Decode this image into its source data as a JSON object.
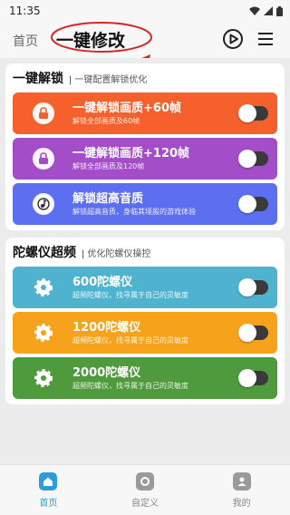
{
  "status_bar": {
    "time": "11:35"
  },
  "header": {
    "nav_home": "首页",
    "title": "一键修改",
    "annotation_color": "#d62828"
  },
  "sections": [
    {
      "title": "一键解锁",
      "subtitle": "一键配置解锁优化",
      "cards": [
        {
          "title": "一键解锁画质+60帧",
          "desc": "解锁全部画质及60帧",
          "color": "#f5602c",
          "icon": "lock-icon",
          "toggle_on": false
        },
        {
          "title": "一键解锁画质+120帧",
          "desc": "解锁全部画质及120帧",
          "color": "#a34dc8",
          "icon": "lock-icon",
          "toggle_on": false
        },
        {
          "title": "解锁超高音质",
          "desc": "解锁超高音质，身临其境般的游戏体验",
          "color": "#5b6ff0",
          "icon": "music-note-icon",
          "toggle_on": false
        }
      ]
    },
    {
      "title": "陀螺仪超频",
      "subtitle": "优化陀螺仪操控",
      "cards": [
        {
          "title": "600陀螺仪",
          "desc": "超频陀螺仪，找寻属于自己的灵敏度",
          "color": "#4fb3d0",
          "icon": "gear-icon",
          "toggle_on": false
        },
        {
          "title": "1200陀螺仪",
          "desc": "超频陀螺仪，找寻属于自己的灵敏度",
          "color": "#f7a21b",
          "icon": "gear-icon",
          "toggle_on": false
        },
        {
          "title": "2000陀螺仪",
          "desc": "超频陀螺仪，找寻属于自己的灵敏度",
          "color": "#4e9a3c",
          "icon": "gear-icon",
          "toggle_on": false
        }
      ]
    }
  ],
  "bottom_nav": [
    {
      "label": "首页",
      "icon": "home-icon",
      "active": true
    },
    {
      "label": "自定义",
      "icon": "customize-icon",
      "active": false
    },
    {
      "label": "我的",
      "icon": "profile-icon",
      "active": false
    }
  ]
}
